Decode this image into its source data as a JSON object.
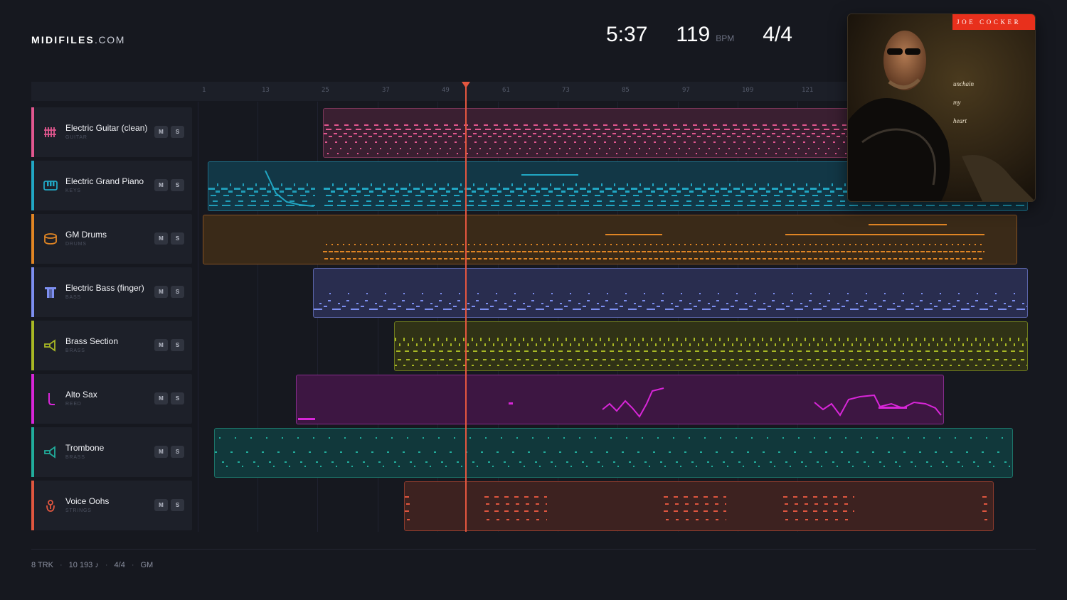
{
  "brand": {
    "name_bold": "MIDIFILES",
    "name_domain": ".COM"
  },
  "header": {
    "duration": "5:37",
    "tempo": "119",
    "tempo_unit": "BPM",
    "time_signature": "4/4"
  },
  "ruler": {
    "ticks": [
      "1",
      "13",
      "25",
      "37",
      "49",
      "61",
      "73",
      "85",
      "97",
      "109",
      "121"
    ]
  },
  "tracks": [
    {
      "name": "Electric Guitar (clean)",
      "category": "GUITAR",
      "color": "#e2578f",
      "icon": "guitar-icon",
      "mute_label": "M",
      "solo_label": "S"
    },
    {
      "name": "Electric Grand Piano",
      "category": "KEYS",
      "color": "#21a7c4",
      "icon": "keyboard-icon",
      "mute_label": "M",
      "solo_label": "S"
    },
    {
      "name": "GM Drums",
      "category": "DRUMS",
      "color": "#e08524",
      "icon": "drum-icon",
      "mute_label": "M",
      "solo_label": "S"
    },
    {
      "name": "Electric Bass (finger)",
      "category": "BASS",
      "color": "#7d8ff0",
      "icon": "bass-icon",
      "mute_label": "M",
      "solo_label": "S"
    },
    {
      "name": "Brass Section",
      "category": "BRASS",
      "color": "#a8b824",
      "icon": "horn-icon",
      "mute_label": "M",
      "solo_label": "S"
    },
    {
      "name": "Alto Sax",
      "category": "REED",
      "color": "#d826d8",
      "icon": "sax-icon",
      "mute_label": "M",
      "solo_label": "S"
    },
    {
      "name": "Trombone",
      "category": "BRASS",
      "color": "#21ad9c",
      "icon": "horn-icon",
      "mute_label": "M",
      "solo_label": "S"
    },
    {
      "name": "Voice Oohs",
      "category": "STRINGS",
      "color": "#e0563f",
      "icon": "voice-icon",
      "mute_label": "M",
      "solo_label": "S"
    }
  ],
  "album": {
    "artist": "JOE COCKER",
    "title_lines": [
      "unchain",
      "my",
      "heart"
    ]
  },
  "footer": {
    "tracks": "8 TRK",
    "notes": "10 193 ♪",
    "time_signature": "4/4",
    "standard": "GM"
  }
}
